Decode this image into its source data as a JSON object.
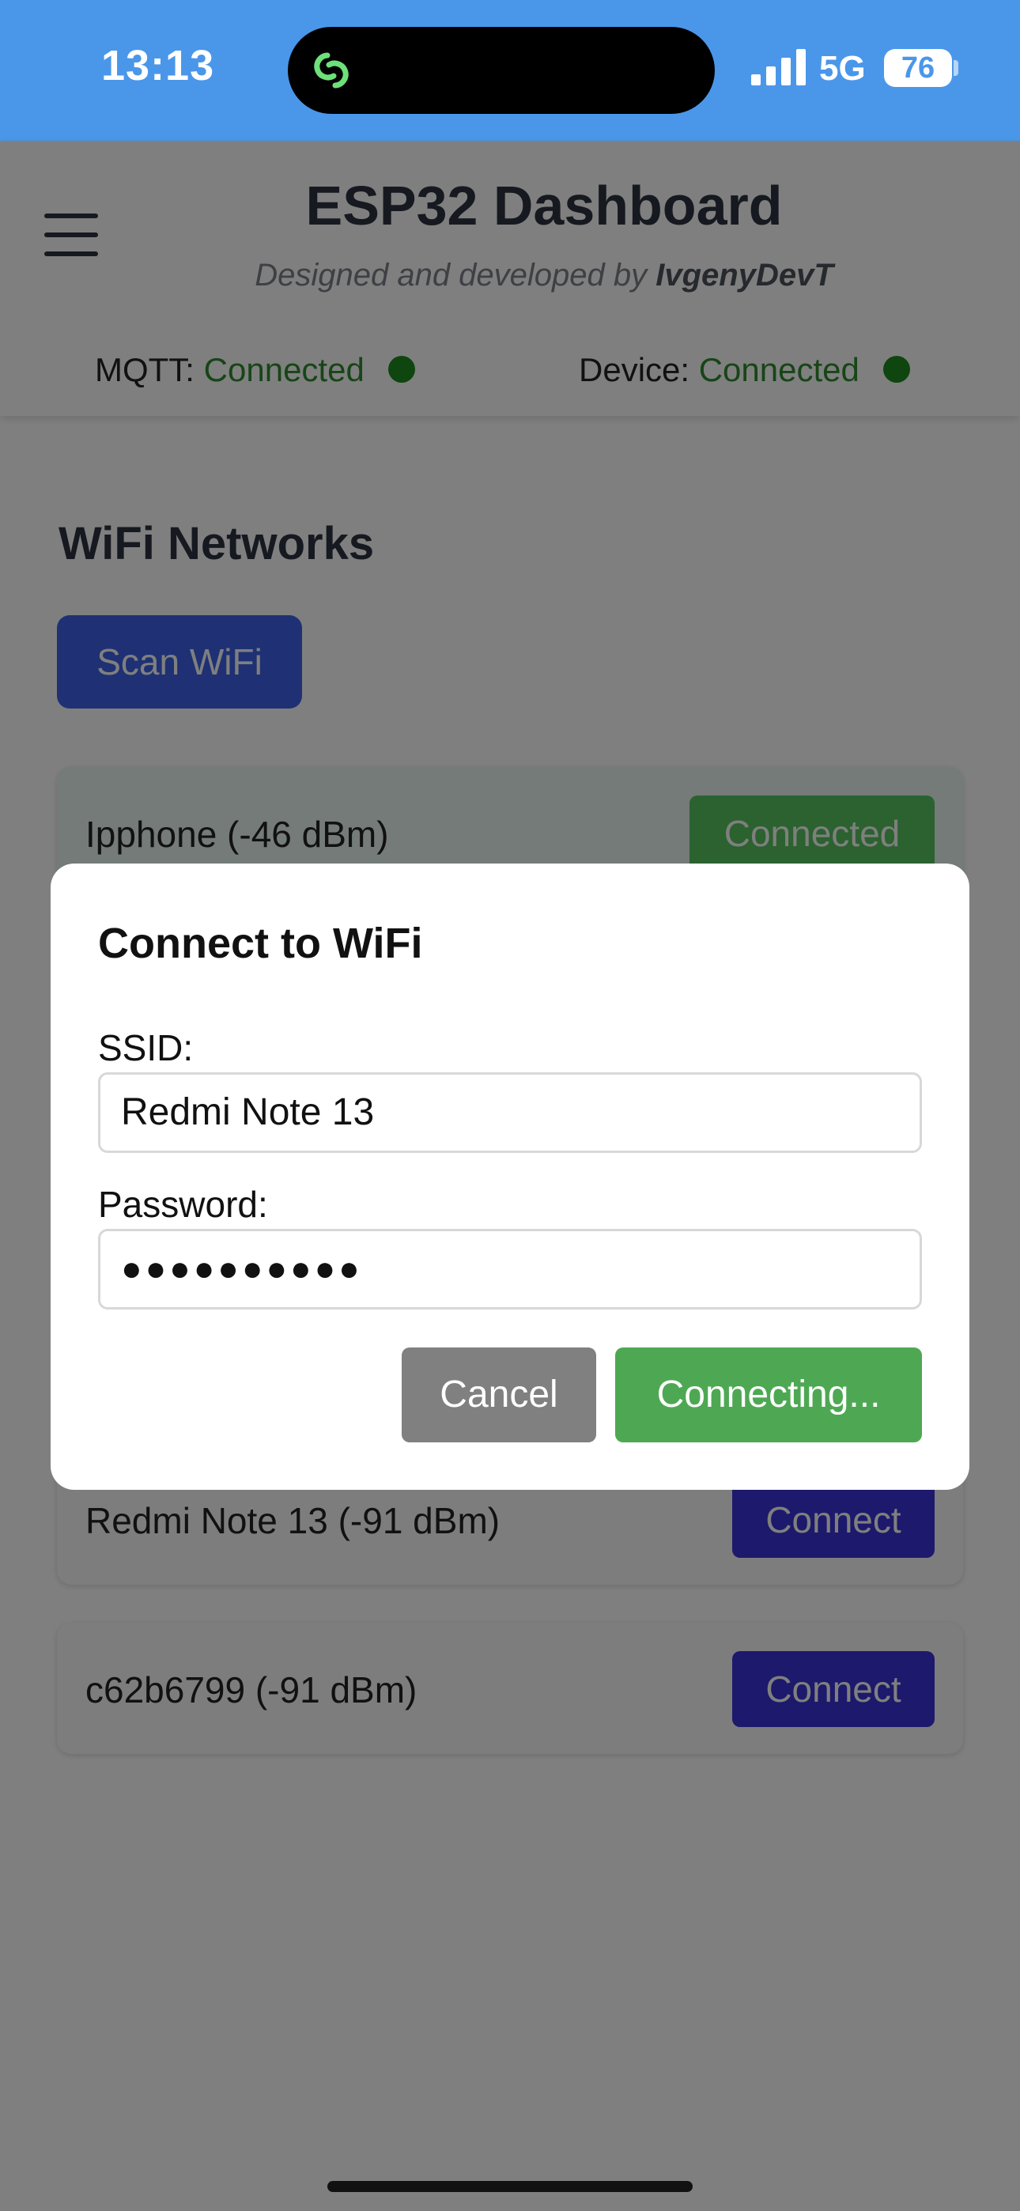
{
  "status_bar": {
    "time": "13:13",
    "network": "5G",
    "battery": "76"
  },
  "header": {
    "title": "ESP32 Dashboard",
    "subtitle_prefix": "Designed and developed by ",
    "subtitle_author": "IvgenyDevT",
    "mqtt_label": "MQTT: ",
    "mqtt_status": "Connected",
    "device_label": "Device: ",
    "device_status": "Connected"
  },
  "main": {
    "section_title": "WiFi Networks",
    "scan_button": "Scan WiFi",
    "networks": [
      {
        "name": "Ipphone (-46 dBm)",
        "button": "Connected"
      },
      {
        "name": "Redmi Note 13 (-91 dBm)",
        "button": "Connect"
      },
      {
        "name": "c62b6799 (-91 dBm)",
        "button": "Connect"
      }
    ]
  },
  "modal": {
    "title": "Connect to WiFi",
    "ssid_label": "SSID:",
    "ssid_value": "Redmi Note 13",
    "password_label": "Password:",
    "password_value": "●●●●●●●●●●",
    "cancel_button": "Cancel",
    "submit_button": "Connecting..."
  },
  "colors": {
    "status_bar": "#4a97ea",
    "scan_button": "#3f63e8",
    "connect_button": "#3b33d8",
    "connected_button": "#57c55f",
    "connecting_button": "#4ea853",
    "status_ok": "#2e8b2e"
  }
}
